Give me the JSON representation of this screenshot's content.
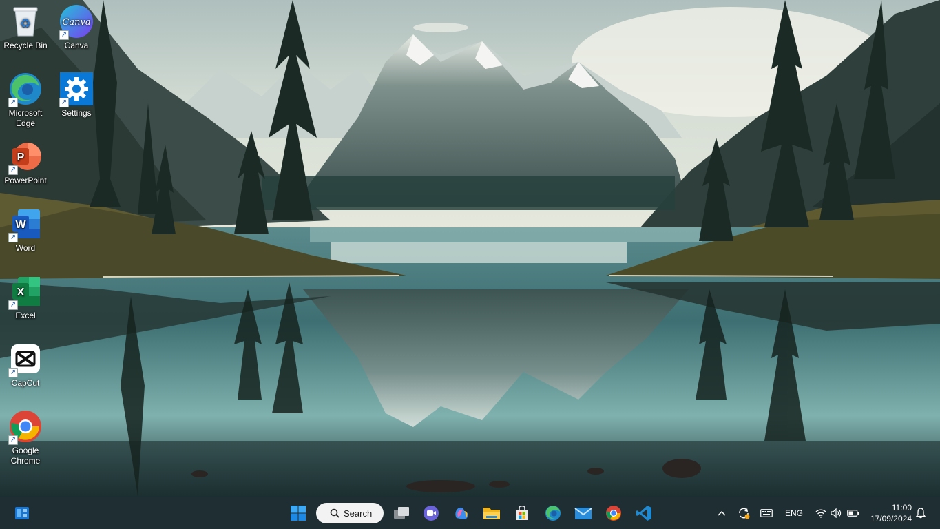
{
  "desktop": {
    "icons": [
      {
        "label": "Recycle Bin",
        "icon": "recycle-bin-icon"
      },
      {
        "label": "Canva",
        "icon": "canva-icon",
        "logo_text": "Canva"
      },
      {
        "label": "Microsoft Edge",
        "icon": "edge-icon"
      },
      {
        "label": "Settings",
        "icon": "gear-icon"
      },
      {
        "label": "PowerPoint",
        "icon": "powerpoint-icon",
        "logo_text": "P"
      },
      {
        "label": "Word",
        "icon": "word-icon",
        "logo_text": "W"
      },
      {
        "label": "Excel",
        "icon": "excel-icon",
        "logo_text": "X"
      },
      {
        "label": "CapCut",
        "icon": "capcut-icon"
      },
      {
        "label": "Google Chrome",
        "icon": "chrome-icon"
      }
    ]
  },
  "taskbar": {
    "search_label": "Search",
    "pinned": [
      "start-icon",
      "search-icon",
      "task-view-icon",
      "meet-icon",
      "copilot-icon",
      "file-explorer-icon",
      "store-icon",
      "edge-icon",
      "mail-icon",
      "chrome-icon",
      "vscode-icon"
    ],
    "tray": {
      "language": "ENG",
      "time": "11:00",
      "date": "17/09/2024"
    }
  },
  "colors": {
    "taskbar_bg": "#1f2e33",
    "accent_blue": "#0078d4"
  }
}
